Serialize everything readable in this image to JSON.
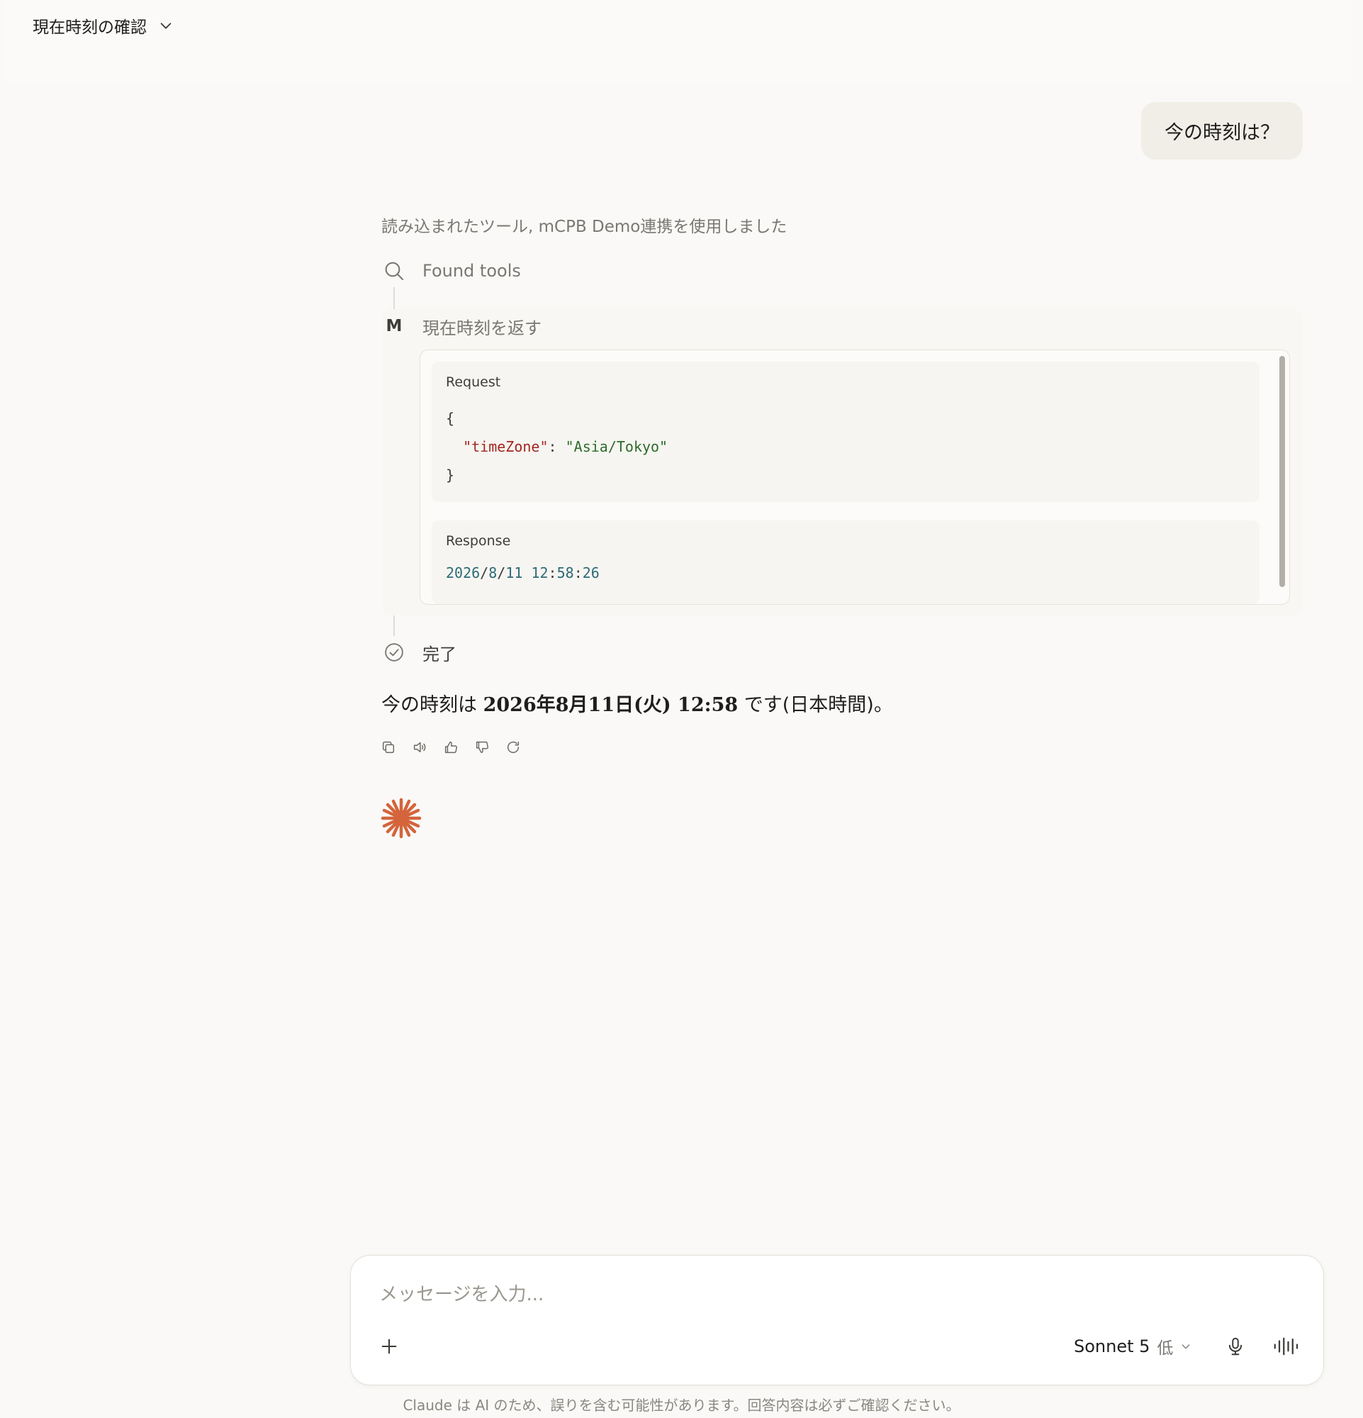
{
  "header": {
    "title": "現在時刻の確認"
  },
  "user_message": "今の時刻は？",
  "tool_summary": "読み込まれたツール, mCPB Demo連携を使用しました",
  "steps": {
    "found_tools": "Found tools",
    "tool_badge": "M",
    "tool_call": "現在時刻を返す",
    "done": "完了"
  },
  "request": {
    "label": "Request",
    "open": "{",
    "key": "\"timeZone\"",
    "colon": ": ",
    "value": "\"Asia/Tokyo\"",
    "close": "}"
  },
  "response": {
    "label": "Response",
    "year": "2026",
    "month": "8",
    "day": "11",
    "hour": "12",
    "minute": "58",
    "second": "26"
  },
  "answer": {
    "prefix": "今の時刻は ",
    "bold": "2026年8月11日(火) 12:58",
    "suffix": " です(日本時間)。"
  },
  "composer": {
    "placeholder": "メッセージを入力...",
    "model": "Sonnet 5",
    "level": "低"
  },
  "disclaimer": "Claude は AI のため、誤りを含む可能性があります。回答内容は必ずご確認ください。",
  "colors": {
    "accent": "#D4643B",
    "json_key": "#A3261F",
    "json_string": "#2E6B2A",
    "number": "#2D6B78"
  }
}
